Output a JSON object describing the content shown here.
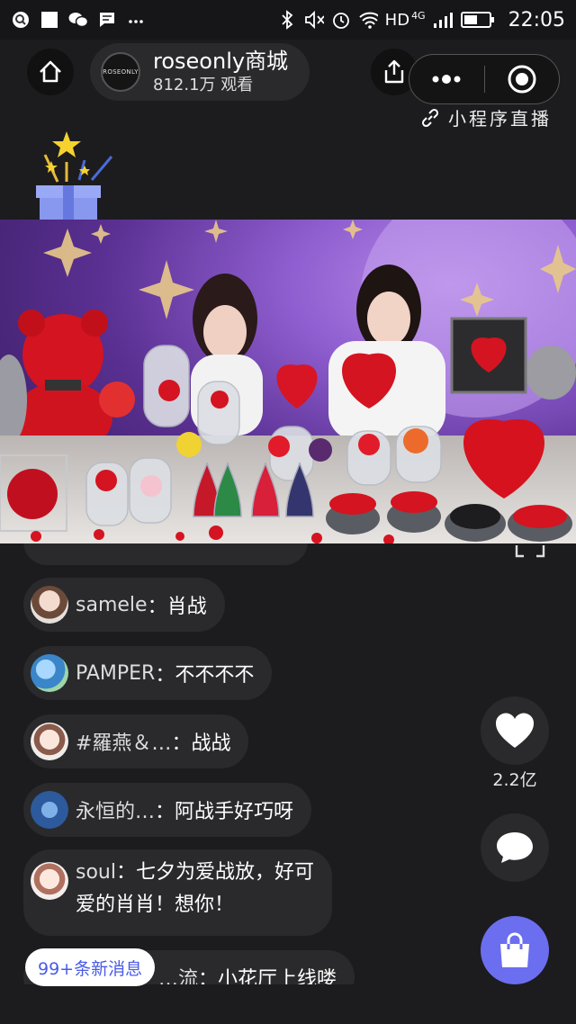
{
  "status_bar": {
    "network": "HD",
    "network_gen": "4G",
    "time": "22:05",
    "icons": [
      "search-icon",
      "square-icon",
      "wechat-icon",
      "message-icon",
      "more-icon",
      "bluetooth-icon",
      "mute-icon",
      "alarm-icon",
      "wifi-icon",
      "signal-icon",
      "battery-icon"
    ]
  },
  "header": {
    "avatar_text": "ROSEONLY",
    "anchor_name": "roseonly商城",
    "views": "812.1万 观看",
    "mini_program_label": "小程序直播"
  },
  "comments": [
    {
      "name": "samele",
      "sep": "：",
      "text": "肖战"
    },
    {
      "name": "PAMPER",
      "sep": "：",
      "text": "不不不不"
    },
    {
      "name": "#羅燕＆…",
      "sep": " ：",
      "text": "战战"
    },
    {
      "name": "永恒的…",
      "sep": " ：",
      "text": "阿战手好巧呀"
    },
    {
      "name": "soul",
      "sep": "：",
      "text": "七夕为爱战放，好可",
      "text2": "爱的肖肖！想你！"
    },
    {
      "name": "…流",
      "sep": "：",
      "text": "小花厅上线喽"
    }
  ],
  "actions": {
    "like_count": "2.2亿"
  },
  "new_messages": "99+条新消息",
  "colors": {
    "background": "#1c1c1e",
    "bubble": "#2a2a2c",
    "cart": "#6c6ef0",
    "new_messages_text": "#4a5be6"
  }
}
